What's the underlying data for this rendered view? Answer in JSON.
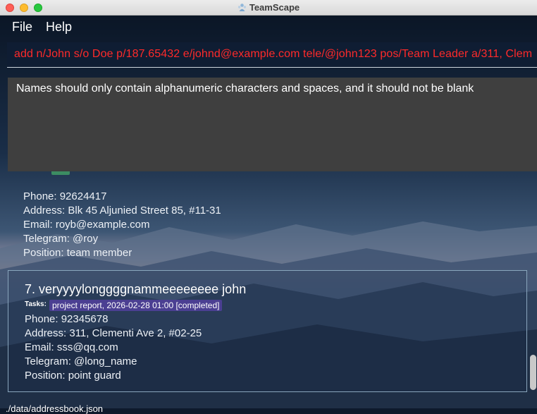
{
  "window": {
    "title": "TeamScape"
  },
  "menu": {
    "file_label": "File",
    "help_label": "Help"
  },
  "command_box": {
    "value": "add n/John s/o Doe p/187.65432 e/johnd@example.com tele/@john123 pos/Team Leader a/311, Clem",
    "color": "#ff2a2a"
  },
  "result_display": {
    "message": "Names should only contain alphanumeric characters and spaces, and it should not be blank"
  },
  "people": [
    {
      "phone": "Phone: 92624417",
      "address": "Address: Blk 45 Aljunied Street 85, #11-31",
      "email": "Email: royb@example.com",
      "telegram": "Telegram: @roy",
      "position": "Position: team member"
    },
    {
      "name": "7. veryyyylonggggnammeeeeeeee john",
      "tasks_label": "Tasks:",
      "task": "project report, 2026-02-28 01:00 [completed]",
      "phone": "Phone: 92345678",
      "address": "Address: 311, Clementi Ave 2, #02-25",
      "email": "Email: sss@qq.com",
      "telegram": "Telegram: @long_name",
      "position": "Position: point guard"
    }
  ],
  "status_bar": {
    "path": "./data/addressbook.json"
  },
  "colors": {
    "task_chip": "#4b3f92",
    "result_bg": "#3f3f3f",
    "tag": "#3c8c62"
  },
  "icons": {
    "app": "teamscape-app-icon"
  }
}
